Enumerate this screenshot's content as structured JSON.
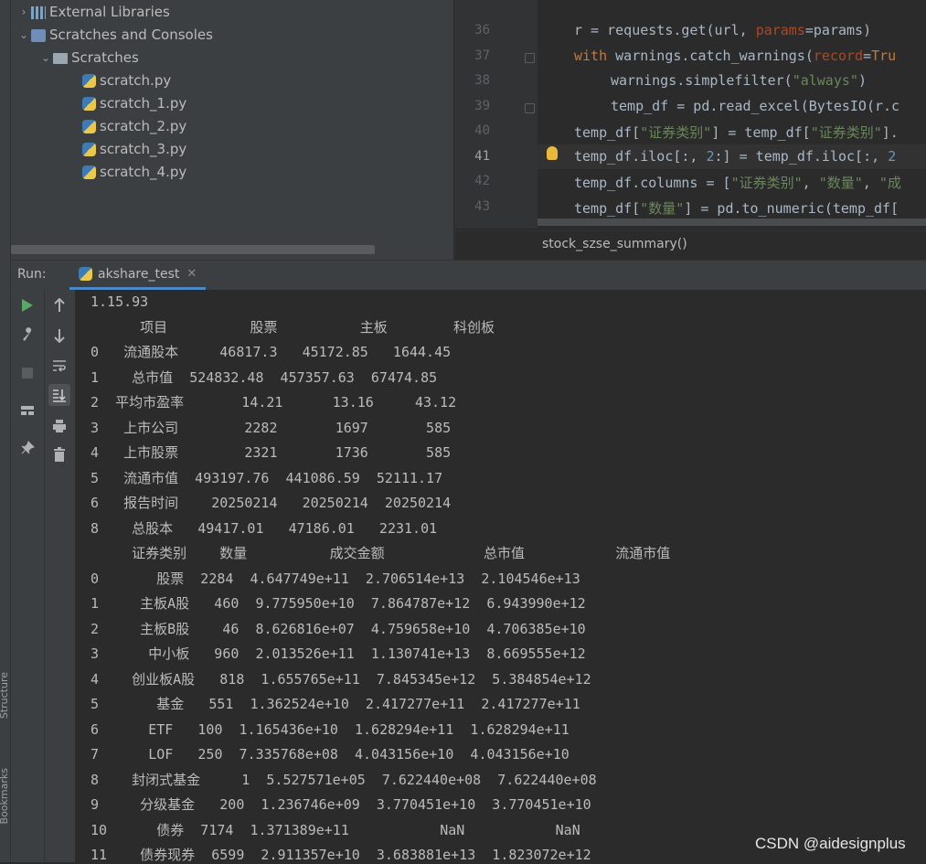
{
  "edge": {
    "structure_label": "Structure",
    "bookmarks_label": "Bookmarks"
  },
  "project_tree": {
    "external_libraries": "External Libraries",
    "scratches_and_consoles": "Scratches and Consoles",
    "scratches": "Scratches",
    "files": [
      "scratch.py",
      "scratch_1.py",
      "scratch_2.py",
      "scratch_3.py",
      "scratch_4.py"
    ]
  },
  "editor": {
    "line_numbers": [
      "36",
      "37",
      "38",
      "39",
      "40",
      "41",
      "42",
      "43"
    ],
    "current_line": "41",
    "breadcrumb": "stock_szse_summary()"
  },
  "run": {
    "label": "Run:",
    "tab_label": "akshare_test"
  },
  "console": {
    "lines": [
      "1.15.93",
      "      项目          股票          主板        科创板",
      "0   流通股本     46817.3   45172.85   1644.45",
      "1    总市值  524832.48  457357.63  67474.85",
      "2  平均市盈率       14.21      13.16     43.12",
      "3   上市公司        2282       1697       585",
      "4   上市股票        2321       1736       585",
      "5   流通市值  493197.76  441086.59  52111.17",
      "6   报告时间    20250214   20250214  20250214",
      "8    总股本   49417.01   47186.01   2231.01",
      "     证券类别    数量          成交金额            总市值           流通市值",
      "0       股票  2284  4.647749e+11  2.706514e+13  2.104546e+13",
      "1     主板A股   460  9.775950e+10  7.864787e+12  6.943990e+12",
      "2     主板B股    46  8.626816e+07  4.759658e+10  4.706385e+10",
      "3      中小板   960  2.013526e+11  1.130741e+13  8.669555e+12",
      "4    创业板A股   818  1.655765e+11  7.845345e+12  5.384854e+12",
      "5       基金   551  1.362524e+10  2.417277e+11  2.417277e+11",
      "6      ETF   100  1.165436e+10  1.628294e+11  1.628294e+11",
      "7      LOF   250  7.335768e+08  4.043156e+10  4.043156e+10",
      "8    封闭式基金     1  5.527571e+05  7.622440e+08  7.622440e+08",
      "9     分级基金   200  1.236746e+09  3.770451e+10  3.770451e+10",
      "10      债券  7174  1.371389e+11           NaN           NaN",
      "11    债券现券  6599  2.911357e+10  3.683881e+13  1.823072e+12"
    ]
  },
  "watermark": "CSDN @aidesignplus",
  "colors": {
    "keyword": "#cc7832",
    "string": "#6a8759",
    "param": "#aa4926",
    "accent": "#4a88c7"
  }
}
